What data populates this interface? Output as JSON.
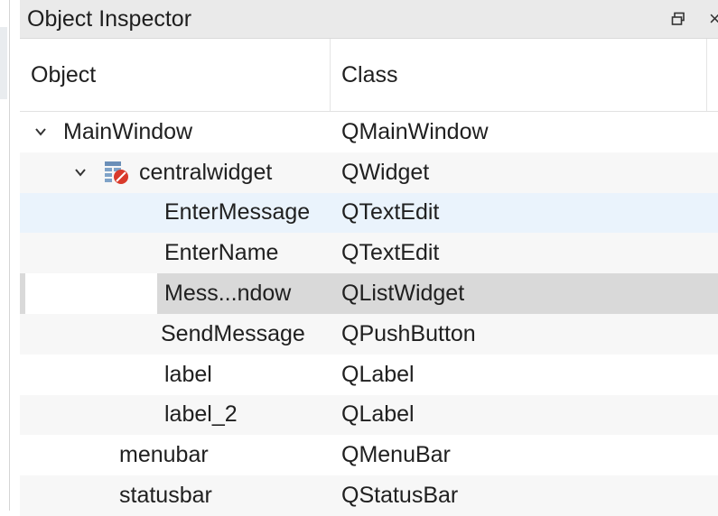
{
  "panel": {
    "title": "Object Inspector"
  },
  "header": {
    "object": "Object",
    "class": "Class"
  },
  "rows": [
    {
      "object": "MainWindow",
      "class": "QMainWindow"
    },
    {
      "object": "centralwidget",
      "class": "QWidget"
    },
    {
      "object": "EnterMessage",
      "class": "QTextEdit"
    },
    {
      "object": "EnterName",
      "class": "QTextEdit"
    },
    {
      "object": "Mess...ndow",
      "class": "QListWidget"
    },
    {
      "object": "SendMessage",
      "class": "QPushButton"
    },
    {
      "object": "label",
      "class": "QLabel"
    },
    {
      "object": "label_2",
      "class": "QLabel"
    },
    {
      "object": "menubar",
      "class": "QMenuBar"
    },
    {
      "object": "statusbar",
      "class": "QStatusBar"
    }
  ],
  "colors": {
    "title_bg": "#eaeaea",
    "hover_row": "#eaf3fc",
    "selected_row": "#d9d9d9"
  },
  "icons": {
    "expand": "chevron-down-icon",
    "widget": "widget-layout-broken-icon",
    "float": "float-dock-icon",
    "close": "close-icon"
  }
}
